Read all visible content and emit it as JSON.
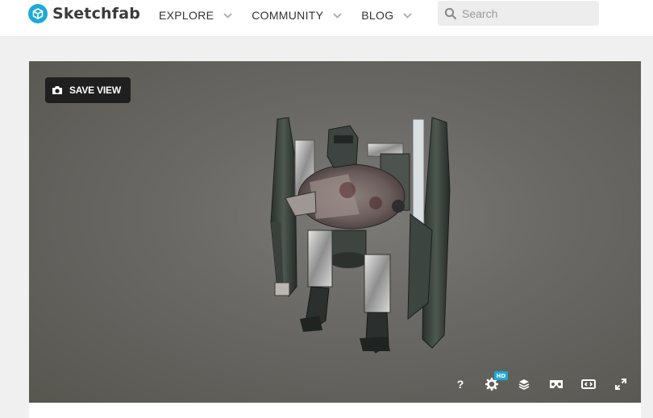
{
  "header": {
    "logo_text": "Sketchfab",
    "nav": [
      {
        "label": "EXPLORE"
      },
      {
        "label": "COMMUNITY"
      },
      {
        "label": "BLOG"
      }
    ],
    "search": {
      "placeholder": "Search",
      "value": ""
    }
  },
  "viewer": {
    "save_view_label": "SAVE VIEW",
    "controls": {
      "help_label": "?",
      "hd_badge": "HD"
    }
  },
  "colors": {
    "brand": "#1caad9",
    "header_bg": "#ffffff",
    "page_bg": "#f0f0f0",
    "button_bg": "#1f1f1f"
  },
  "icons": [
    "logo-cube-icon",
    "chevron-down-icon",
    "search-icon",
    "camera-icon",
    "settings-gear-icon",
    "layers-icon",
    "vr-headset-icon",
    "embed-code-icon",
    "fullscreen-icon"
  ]
}
